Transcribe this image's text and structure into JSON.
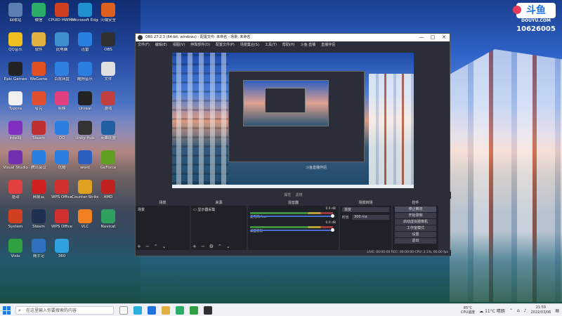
{
  "colors": {
    "accent": "#1f7be0",
    "obs_bg": "#2b2e38",
    "dock_bg": "#1f2129"
  },
  "douyu": {
    "brand": "斗鱼",
    "url": "DOUYU.COM",
    "room": "10626005"
  },
  "desktop_icons": [
    {
      "label": "回收站",
      "icon": "recycle-bin-icon",
      "color": "#5a7fb0"
    },
    {
      "label": "微信",
      "icon": "wechat-icon",
      "color": "#2aae67"
    },
    {
      "label": "CPUID HWMonitor",
      "icon": "cpuid-icon",
      "color": "#d04020"
    },
    {
      "label": "Microsoft Edge",
      "icon": "edge-icon",
      "color": "#1f8fd0"
    },
    {
      "label": "火绒安全",
      "icon": "huorong-icon",
      "color": "#e06020"
    },
    {
      "label": "QQ音乐",
      "icon": "qqmusic-icon",
      "color": "#f0c020"
    },
    {
      "label": "软件",
      "icon": "folder-icon",
      "color": "#e0b040"
    },
    {
      "label": "此电脑",
      "icon": "pc-icon",
      "color": "#4090d0"
    },
    {
      "label": "迅雷",
      "icon": "xunlei-icon",
      "color": "#2a80e0"
    },
    {
      "label": "OBS",
      "icon": "obs-icon",
      "color": "#303030"
    },
    {
      "label": "Epic Games",
      "icon": "epic-icon",
      "color": "#222222"
    },
    {
      "label": "WeGame",
      "icon": "wegame-icon",
      "color": "#e05020"
    },
    {
      "label": "百度网盘",
      "icon": "baidu-icon",
      "color": "#3080e0"
    },
    {
      "label": "酷狗音乐",
      "icon": "kugou-icon",
      "color": "#2a7fe0"
    },
    {
      "label": "文件",
      "icon": "file-icon",
      "color": "#e0e0e0"
    },
    {
      "label": "Typora",
      "icon": "typora-icon",
      "color": "#f0f0f0"
    },
    {
      "label": "夸克",
      "icon": "quark-icon",
      "color": "#e05030"
    },
    {
      "label": "剪映",
      "icon": "jianying-icon",
      "color": "#e04080"
    },
    {
      "label": "Unreal",
      "icon": "unreal-icon",
      "color": "#222222"
    },
    {
      "label": "游戏",
      "icon": "game-icon",
      "color": "#c04040"
    },
    {
      "label": "IntelliJ",
      "icon": "intellij-icon",
      "color": "#8030c0"
    },
    {
      "label": "Steam",
      "icon": "steam-icon",
      "color": "#c03030"
    },
    {
      "label": "QQ",
      "icon": "qq-icon",
      "color": "#2a7fe0"
    },
    {
      "label": "Unity Hub",
      "icon": "unity-icon",
      "color": "#333333"
    },
    {
      "label": "英雄联盟",
      "icon": "lol-icon",
      "color": "#2060a0"
    },
    {
      "label": "Visual Studio",
      "icon": "vs-icon",
      "color": "#7030b0"
    },
    {
      "label": "腾讯会议",
      "icon": "meeting-icon",
      "color": "#2a80e0"
    },
    {
      "label": "优酷",
      "icon": "youku-icon",
      "color": "#2a7fe0"
    },
    {
      "label": "word",
      "icon": "word-icon",
      "color": "#2a60c0"
    },
    {
      "label": "GeForce",
      "icon": "geforce-icon",
      "color": "#60a020"
    },
    {
      "label": "驱动",
      "icon": "driver-icon",
      "color": "#e04040"
    },
    {
      "label": "网易云",
      "icon": "netease-icon",
      "color": "#d02020"
    },
    {
      "label": "WPS Office",
      "icon": "wps-icon",
      "color": "#d03030"
    },
    {
      "label": "Counter-Strike",
      "icon": "cs-icon",
      "color": "#e0a020"
    },
    {
      "label": "AMD",
      "icon": "amd-icon",
      "color": "#c02020"
    },
    {
      "label": "System",
      "icon": "system-icon",
      "color": "#d04020"
    },
    {
      "label": "Steam",
      "icon": "steam2-icon",
      "color": "#203050"
    },
    {
      "label": "WPS Office",
      "icon": "wps2-icon",
      "color": "#d03030"
    },
    {
      "label": "VLC",
      "icon": "vlc-icon",
      "color": "#f08020"
    },
    {
      "label": "Navicat",
      "icon": "navicat-icon",
      "color": "#30a060"
    },
    {
      "label": "Visio",
      "icon": "visio-icon",
      "color": "#30a040"
    },
    {
      "label": "随手记",
      "icon": "note-icon",
      "color": "#3070c0"
    },
    {
      "label": "360",
      "icon": "360-icon",
      "color": "#30a0e0"
    }
  ],
  "obs": {
    "title": "OBS 27.2.3 (64-bit, windows) - 配置文件: 未命名 - 场景: 未命名",
    "menus": [
      "文件(F)",
      "编辑(E)",
      "视图(V)",
      "停靠部件(D)",
      "配置文件(P)",
      "场景集合(S)",
      "工具(T)",
      "帮助(H)",
      "斗鱼·直播",
      "直播伴侣"
    ],
    "preview_chip": "斗鱼直播伴侣",
    "source_bar": {
      "props": "属性",
      "filters": "滤镜"
    },
    "docks": {
      "scenes": {
        "title": "场景",
        "items": [
          "场景"
        ]
      },
      "sources": {
        "title": "来源",
        "items": [
          "显示器采集"
        ]
      },
      "mixer": {
        "title": "混音器",
        "channels": [
          {
            "name": "麦克风/Aux",
            "db": "0.0 dB"
          },
          {
            "name": "桌面音频",
            "db": "0.0 dB"
          }
        ]
      },
      "transitions": {
        "title": "场景转场",
        "type": "渐变",
        "duration_label": "时长",
        "duration": "300 ms"
      },
      "controls": {
        "title": "控件",
        "buttons": [
          "停止推流",
          "开始录制",
          "启动虚拟摄像机",
          "工作室模式",
          "设置",
          "退出"
        ]
      }
    },
    "status": {
      "live": "LIVE: 00:00:00",
      "rec": "REC: 00:00:00",
      "cpu": "CPU: 2.1%, 60.00 fps"
    }
  },
  "taskbar": {
    "search_placeholder": "在这里输入你要搜索的内容",
    "temp": "85°C",
    "cpu_temp": "CPU温度",
    "weather": "11°C 晴朗",
    "time": "21:59",
    "date": "2022/03/06"
  }
}
